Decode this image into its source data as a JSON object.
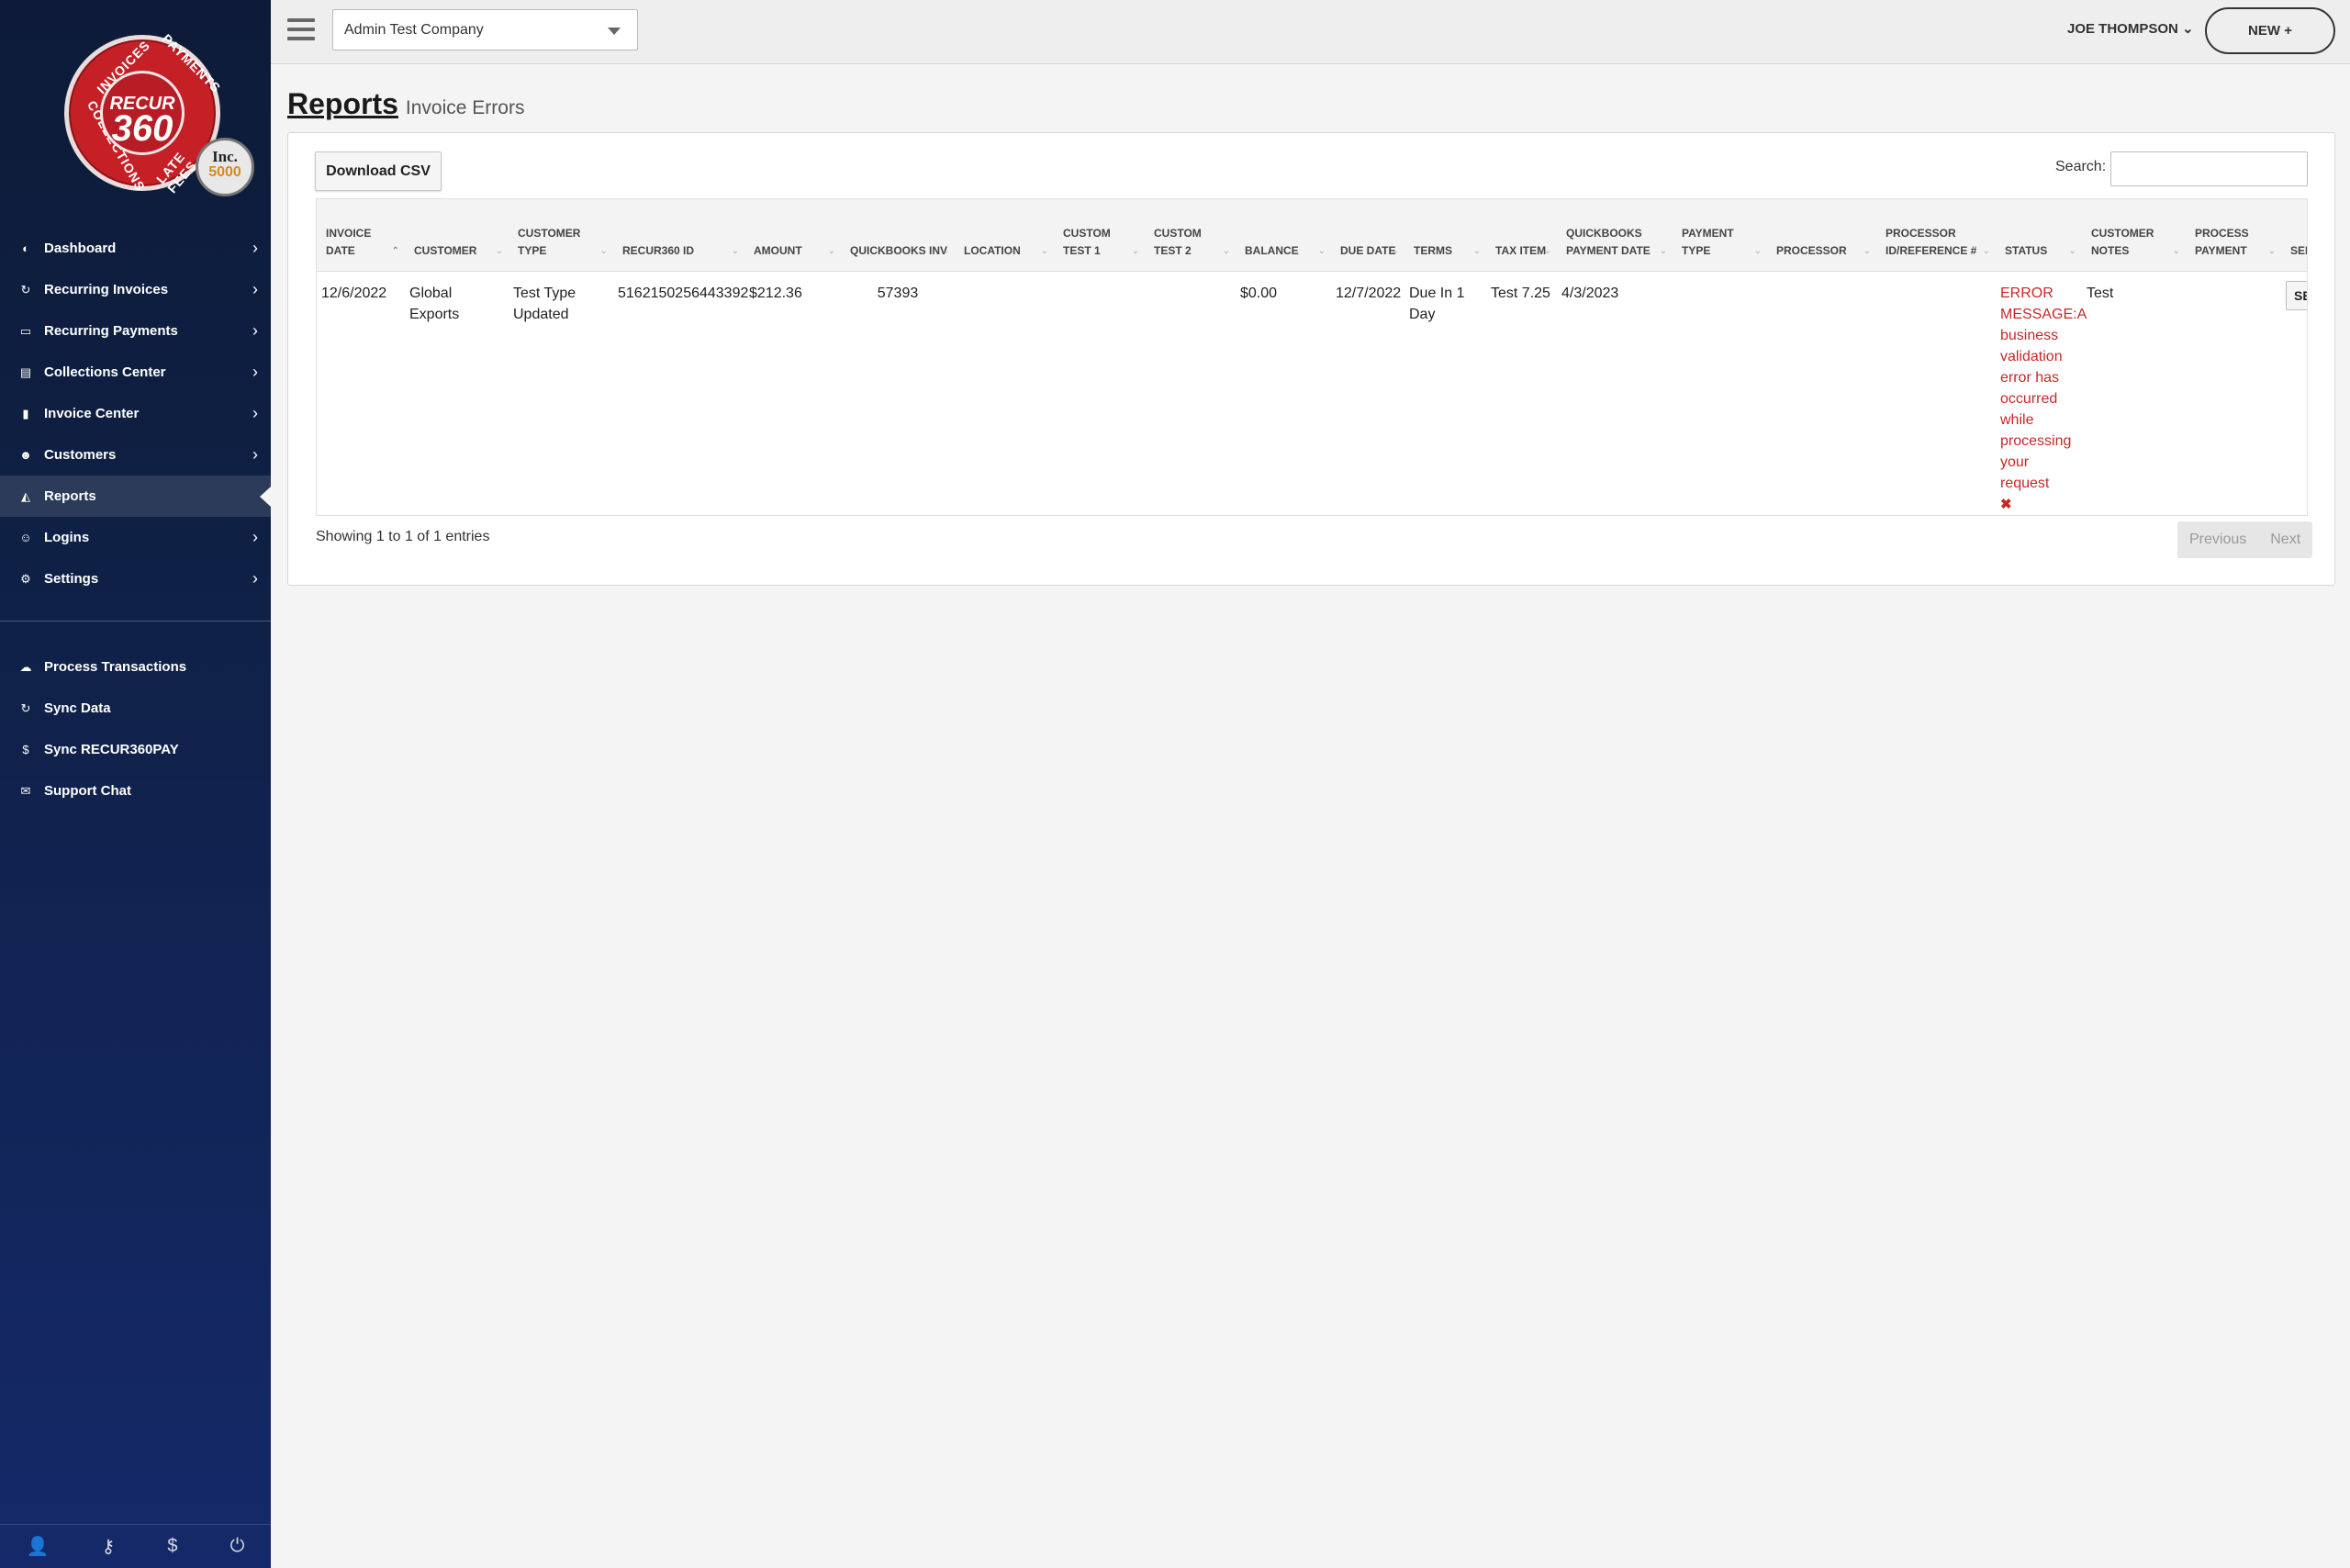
{
  "brand": {
    "seal_word": "RECUR",
    "seal_number": "360",
    "seal_ring": [
      "INVOICES",
      "PAYMENTS",
      "COLLECTIONS",
      "LATE FEES"
    ],
    "badge_name": "Inc.",
    "badge_number": "5000",
    "colors": {
      "seal_red": "#c62027",
      "sidebar_navy": "#0f2147"
    }
  },
  "sidebar": {
    "items": [
      {
        "label": "Dashboard",
        "icon": "dashboard-gauge-icon",
        "glyph": "◐"
      },
      {
        "label": "Recurring Invoices",
        "icon": "refresh-icon",
        "glyph": "↻"
      },
      {
        "label": "Recurring Payments",
        "icon": "credit-card-icon",
        "glyph": "▭"
      },
      {
        "label": "Collections Center",
        "icon": "document-icon",
        "glyph": "▤"
      },
      {
        "label": "Invoice Center",
        "icon": "file-icon",
        "glyph": "▮"
      },
      {
        "label": "Customers",
        "icon": "users-icon",
        "glyph": "☻"
      },
      {
        "label": "Reports",
        "icon": "area-chart-icon",
        "glyph": "◭"
      },
      {
        "label": "Logins",
        "icon": "user-key-icon",
        "glyph": "☺"
      },
      {
        "label": "Settings",
        "icon": "cogs-icon",
        "glyph": "⚙"
      }
    ],
    "actions": [
      {
        "label": "Process Transactions",
        "icon": "cloud-upload-icon",
        "glyph": "☁"
      },
      {
        "label": "Sync Data",
        "icon": "sync-icon",
        "glyph": "↻"
      },
      {
        "label": "Sync RECUR360PAY",
        "icon": "dollar-icon",
        "glyph": "$"
      },
      {
        "label": "Support Chat",
        "icon": "comments-icon",
        "glyph": "✉"
      }
    ],
    "footer": [
      {
        "icon": "user-icon",
        "glyph": "👤"
      },
      {
        "icon": "key-icon",
        "glyph": "⚷"
      },
      {
        "icon": "dollar-icon",
        "glyph": "$"
      },
      {
        "icon": "power-icon",
        "glyph": "⏻"
      }
    ]
  },
  "topbar": {
    "company": "Admin Test Company",
    "user": "JOE THOMPSON",
    "user_caret": "⌄",
    "new_button": "NEW +"
  },
  "page": {
    "title": "Reports",
    "subtitle": "Invoice Errors"
  },
  "toolbar": {
    "download_csv": "Download CSV",
    "search_label": "Search:",
    "search_value": ""
  },
  "table": {
    "columns": [
      {
        "label": "INVOICE DATE",
        "sort": "⌃"
      },
      {
        "label": "CUSTOMER",
        "sort": "⌄"
      },
      {
        "label": "CUSTOMER TYPE",
        "sort": "⌄"
      },
      {
        "label": "RECUR360 ID",
        "sort": "⌄"
      },
      {
        "label": "AMOUNT",
        "sort": "⌄"
      },
      {
        "label": "QUICKBOOKS INV",
        "sort": "⌄"
      },
      {
        "label": "LOCATION",
        "sort": "⌄"
      },
      {
        "label": "CUSTOM TEST 1",
        "sort": "⌄"
      },
      {
        "label": "CUSTOM TEST 2",
        "sort": "⌄"
      },
      {
        "label": "BALANCE",
        "sort": "⌄"
      },
      {
        "label": "DUE DATE",
        "sort": "⌄"
      },
      {
        "label": "TERMS",
        "sort": "⌄"
      },
      {
        "label": "TAX ITEM",
        "sort": "⌄"
      },
      {
        "label": "QUICKBOOKS PAYMENT DATE",
        "sort": "⌄"
      },
      {
        "label": "PAYMENT TYPE",
        "sort": "⌄"
      },
      {
        "label": "PROCESSOR",
        "sort": "⌄"
      },
      {
        "label": "PROCESSOR ID/REFERENCE #",
        "sort": "⌄"
      },
      {
        "label": "STATUS",
        "sort": "⌄"
      },
      {
        "label": "CUSTOMER NOTES",
        "sort": "⌄"
      },
      {
        "label": "PROCESS PAYMENT",
        "sort": "⌄"
      },
      {
        "label": "SEND EMAIL",
        "sort": "⌄"
      }
    ],
    "rows": [
      {
        "invoice_date": "12/6/2022",
        "customer": "Global Exports",
        "customer_type": "Test Type Updated",
        "recur360_id": "5162150256443392",
        "amount": "$212.36",
        "quickbooks_inv": "57393",
        "location": "",
        "custom_test_1": "",
        "custom_test_2": "",
        "balance": "$0.00",
        "due_date": "12/7/2022",
        "terms": "Due In 1 Day",
        "tax_item": "Test 7.25",
        "quickbooks_payment_date": "4/3/2023",
        "payment_type": "",
        "processor": "",
        "processor_reference": "",
        "status": "ERROR MESSAGE:A business validation error has occurred while processing your request",
        "status_icon": "✖",
        "customer_notes": "Test",
        "process_payment": "",
        "send_email_button": "SEND"
      }
    ]
  },
  "footer": {
    "info": "Showing 1 to 1 of 1 entries",
    "previous": "Previous",
    "next": "Next"
  }
}
